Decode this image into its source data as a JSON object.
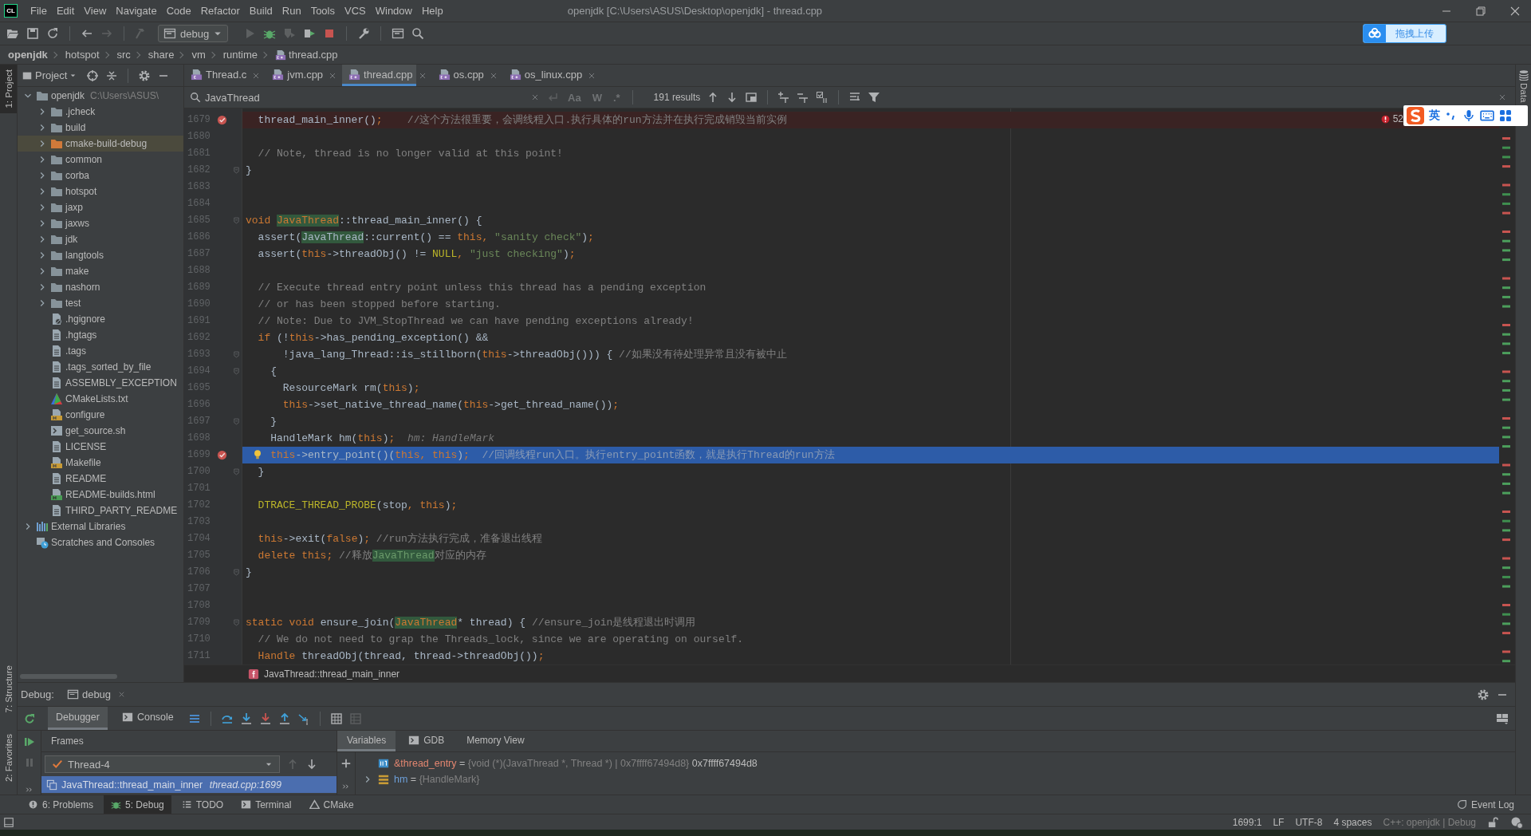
{
  "window": {
    "app_logo": "CL",
    "title": "openjdk [C:\\Users\\ASUS\\Desktop\\openjdk] - thread.cpp"
  },
  "menu": [
    "File",
    "Edit",
    "View",
    "Navigate",
    "Code",
    "Refactor",
    "Build",
    "Run",
    "Tools",
    "VCS",
    "Window",
    "Help"
  ],
  "toolbar": {
    "run_configuration": "debug"
  },
  "upload_widget": {
    "label": "拖拽上传"
  },
  "navigation_bar": [
    {
      "label": "openjdk",
      "kind": "project"
    },
    {
      "label": "hotspot",
      "kind": "folder"
    },
    {
      "label": "src",
      "kind": "folder"
    },
    {
      "label": "share",
      "kind": "folder"
    },
    {
      "label": "vm",
      "kind": "folder"
    },
    {
      "label": "runtime",
      "kind": "folder"
    },
    {
      "label": "thread.cpp",
      "kind": "cpp-file"
    }
  ],
  "left_tool_strip": {
    "top": [
      {
        "label": "1: Project",
        "selected": true
      }
    ],
    "bottom": [
      {
        "label": "7: Structure",
        "selected": false
      },
      {
        "label": "2: Favorites",
        "selected": false
      }
    ]
  },
  "right_tool_strip": [
    {
      "label": "Data"
    }
  ],
  "project_panel": {
    "title": "Project",
    "tree": [
      {
        "label": "openjdk",
        "path": "C:\\Users\\ASUS\\",
        "kind": "folder",
        "expanded": true,
        "selected": false,
        "children": [
          {
            "label": ".jcheck",
            "kind": "folder",
            "expanded": false,
            "selected": false
          },
          {
            "label": "build",
            "kind": "folder",
            "expanded": false,
            "selected": false
          },
          {
            "label": "cmake-build-debug",
            "kind": "excluded-folder",
            "expanded": false,
            "selected": true
          },
          {
            "label": "common",
            "kind": "folder",
            "expanded": false,
            "selected": false
          },
          {
            "label": "corba",
            "kind": "folder",
            "expanded": false,
            "selected": false
          },
          {
            "label": "hotspot",
            "kind": "folder",
            "expanded": false,
            "selected": false
          },
          {
            "label": "jaxp",
            "kind": "folder",
            "expanded": false,
            "selected": false
          },
          {
            "label": "jaxws",
            "kind": "folder",
            "expanded": false,
            "selected": false
          },
          {
            "label": "jdk",
            "kind": "folder",
            "expanded": false,
            "selected": false
          },
          {
            "label": "langtools",
            "kind": "folder",
            "expanded": false,
            "selected": false
          },
          {
            "label": "make",
            "kind": "folder",
            "expanded": false,
            "selected": false
          },
          {
            "label": "nashorn",
            "kind": "folder",
            "expanded": false,
            "selected": false
          },
          {
            "label": "test",
            "kind": "folder",
            "expanded": false,
            "selected": false
          },
          {
            "label": ".hgignore",
            "kind": "ignore-file",
            "selected": false
          },
          {
            "label": ".hgtags",
            "kind": "text-file",
            "selected": false
          },
          {
            "label": ".tags",
            "kind": "text-file",
            "selected": false
          },
          {
            "label": ".tags_sorted_by_file",
            "kind": "text-file",
            "selected": false
          },
          {
            "label": "ASSEMBLY_EXCEPTION",
            "kind": "text-file",
            "selected": false
          },
          {
            "label": "CMakeLists.txt",
            "kind": "cmake-file",
            "selected": false
          },
          {
            "label": "configure",
            "kind": "make-file",
            "selected": false
          },
          {
            "label": "get_source.sh",
            "kind": "script-file",
            "selected": false
          },
          {
            "label": "LICENSE",
            "kind": "text-file",
            "selected": false
          },
          {
            "label": "Makefile",
            "kind": "make-file",
            "selected": false
          },
          {
            "label": "README",
            "kind": "text-file",
            "selected": false
          },
          {
            "label": "README-builds.html",
            "kind": "html-file",
            "selected": false
          },
          {
            "label": "THIRD_PARTY_README",
            "kind": "text-file",
            "selected": false
          }
        ]
      },
      {
        "label": "External Libraries",
        "kind": "libraries",
        "expanded": false,
        "selected": false
      },
      {
        "label": "Scratches and Consoles",
        "kind": "scratches",
        "selected": false
      }
    ]
  },
  "editor_tabs": [
    {
      "label": "Thread.c",
      "kind": "c-file",
      "selected": false
    },
    {
      "label": "jvm.cpp",
      "kind": "cpp-file",
      "selected": false
    },
    {
      "label": "thread.cpp",
      "kind": "cpp-file",
      "selected": true
    },
    {
      "label": "os.cpp",
      "kind": "cpp-file",
      "selected": false
    },
    {
      "label": "os_linux.cpp",
      "kind": "cpp-file",
      "selected": false
    }
  ],
  "find_bar": {
    "query": "JavaThread",
    "match_case": "Aa",
    "words": "W",
    "regex": ".*",
    "results": "191 results"
  },
  "editor": {
    "problems": "52",
    "lines": [
      {
        "number": "1679",
        "breakpoint": true,
        "current": false,
        "fold": false,
        "intention": false,
        "tokens": [
          {
            "kind": "plain",
            "text": "  thread_main_inner()"
          },
          {
            "kind": "keyword",
            "text": ";"
          },
          {
            "kind": "comment",
            "text": "    //这个方法很重要，会调线程入口.执行具体的run方法并在执行完成销毁当前实例"
          }
        ]
      },
      {
        "number": "1680",
        "breakpoint": false,
        "current": false,
        "fold": false,
        "intention": false
      },
      {
        "number": "1681",
        "breakpoint": false,
        "current": false,
        "fold": false,
        "intention": false,
        "tokens": [
          {
            "kind": "comment",
            "text": "  // Note, thread is no longer valid at this point!"
          }
        ]
      },
      {
        "number": "1682",
        "breakpoint": false,
        "current": false,
        "fold": true,
        "intention": false,
        "tokens": [
          {
            "kind": "plain",
            "text": "}"
          }
        ]
      },
      {
        "number": "1683",
        "breakpoint": false,
        "current": false,
        "fold": false,
        "intention": false
      },
      {
        "number": "1684",
        "breakpoint": false,
        "current": false,
        "fold": false,
        "intention": false
      },
      {
        "number": "1685",
        "breakpoint": false,
        "current": false,
        "fold": true,
        "intention": false,
        "tokens": [
          {
            "kind": "keyword",
            "text": "void "
          },
          {
            "kind": "match-keyword",
            "text": "JavaThread"
          },
          {
            "kind": "plain",
            "text": "::thread_main_inner() {"
          }
        ]
      },
      {
        "number": "1686",
        "breakpoint": false,
        "current": false,
        "fold": false,
        "intention": false,
        "tokens": [
          {
            "kind": "plain",
            "text": "  assert("
          },
          {
            "kind": "match",
            "text": "JavaThread"
          },
          {
            "kind": "plain",
            "text": "::current() == "
          },
          {
            "kind": "keyword",
            "text": "this, "
          },
          {
            "kind": "string",
            "text": "\"sanity check\""
          },
          {
            "kind": "plain",
            "text": ")"
          },
          {
            "kind": "keyword",
            "text": ";"
          }
        ]
      },
      {
        "number": "1687",
        "breakpoint": false,
        "current": false,
        "fold": false,
        "intention": false,
        "tokens": [
          {
            "kind": "plain",
            "text": "  assert("
          },
          {
            "kind": "keyword",
            "text": "this"
          },
          {
            "kind": "plain",
            "text": "->threadObj() != "
          },
          {
            "kind": "macro",
            "text": "NULL"
          },
          {
            "kind": "keyword",
            "text": ", "
          },
          {
            "kind": "string",
            "text": "\"just checking\""
          },
          {
            "kind": "plain",
            "text": ")"
          },
          {
            "kind": "keyword",
            "text": ";"
          }
        ]
      },
      {
        "number": "1688",
        "breakpoint": false,
        "current": false,
        "fold": false,
        "intention": false
      },
      {
        "number": "1689",
        "breakpoint": false,
        "current": false,
        "fold": false,
        "intention": false,
        "tokens": [
          {
            "kind": "comment",
            "text": "  // Execute thread entry point unless this thread has a pending exception"
          }
        ]
      },
      {
        "number": "1690",
        "breakpoint": false,
        "current": false,
        "fold": false,
        "intention": false,
        "tokens": [
          {
            "kind": "comment",
            "text": "  // or has been stopped before starting."
          }
        ]
      },
      {
        "number": "1691",
        "breakpoint": false,
        "current": false,
        "fold": false,
        "intention": false,
        "tokens": [
          {
            "kind": "comment",
            "text": "  // Note: Due to JVM_StopThread we can have pending exceptions already!"
          }
        ]
      },
      {
        "number": "1692",
        "breakpoint": false,
        "current": false,
        "fold": false,
        "intention": false,
        "tokens": [
          {
            "kind": "keyword",
            "text": "  if "
          },
          {
            "kind": "plain",
            "text": "(!"
          },
          {
            "kind": "keyword",
            "text": "this"
          },
          {
            "kind": "plain",
            "text": "->has_pending_exception() &&"
          }
        ]
      },
      {
        "number": "1693",
        "breakpoint": false,
        "current": false,
        "fold": true,
        "intention": false,
        "tokens": [
          {
            "kind": "plain",
            "text": "      !java_lang_Thread::is_stillborn("
          },
          {
            "kind": "keyword",
            "text": "this"
          },
          {
            "kind": "plain",
            "text": "->threadObj())) { "
          },
          {
            "kind": "comment",
            "text": "//如果没有待处理异常且没有被中止"
          }
        ]
      },
      {
        "number": "1694",
        "breakpoint": false,
        "current": false,
        "fold": true,
        "intention": false,
        "tokens": [
          {
            "kind": "plain",
            "text": "    {"
          }
        ]
      },
      {
        "number": "1695",
        "breakpoint": false,
        "current": false,
        "fold": false,
        "intention": false,
        "tokens": [
          {
            "kind": "plain",
            "text": "      ResourceMark rm("
          },
          {
            "kind": "keyword",
            "text": "this"
          },
          {
            "kind": "plain",
            "text": ")"
          },
          {
            "kind": "keyword",
            "text": ";"
          }
        ]
      },
      {
        "number": "1696",
        "breakpoint": false,
        "current": false,
        "fold": false,
        "intention": false,
        "tokens": [
          {
            "kind": "keyword",
            "text": "      this"
          },
          {
            "kind": "plain",
            "text": "->set_native_thread_name("
          },
          {
            "kind": "keyword",
            "text": "this"
          },
          {
            "kind": "plain",
            "text": "->get_thread_name())"
          },
          {
            "kind": "keyword",
            "text": ";"
          }
        ]
      },
      {
        "number": "1697",
        "breakpoint": false,
        "current": false,
        "fold": true,
        "intention": false,
        "tokens": [
          {
            "kind": "plain",
            "text": "    }"
          }
        ]
      },
      {
        "number": "1698",
        "breakpoint": false,
        "current": false,
        "fold": false,
        "intention": false,
        "tokens": [
          {
            "kind": "plain",
            "text": "    HandleMark hm("
          },
          {
            "kind": "keyword",
            "text": "this"
          },
          {
            "kind": "plain",
            "text": ")"
          },
          {
            "kind": "keyword",
            "text": ";"
          },
          {
            "kind": "hint",
            "text": "  hm: HandleMark"
          }
        ]
      },
      {
        "number": "1699",
        "breakpoint": true,
        "current": true,
        "fold": false,
        "intention": true,
        "tokens": [
          {
            "kind": "keyword",
            "text": "    this"
          },
          {
            "kind": "plain",
            "text": "->entry_point()("
          },
          {
            "kind": "keyword",
            "text": "this, this"
          },
          {
            "kind": "plain",
            "text": ")"
          },
          {
            "kind": "keyword",
            "text": ";"
          },
          {
            "kind": "comment",
            "text": "  //回调线程run入口。执行entry_point函数，就是执行Thread的run方法"
          }
        ]
      },
      {
        "number": "1700",
        "breakpoint": false,
        "current": false,
        "fold": true,
        "intention": false,
        "tokens": [
          {
            "kind": "plain",
            "text": "  }"
          }
        ]
      },
      {
        "number": "1701",
        "breakpoint": false,
        "current": false,
        "fold": false,
        "intention": false
      },
      {
        "number": "1702",
        "breakpoint": false,
        "current": false,
        "fold": false,
        "intention": false,
        "tokens": [
          {
            "kind": "macro",
            "text": "  DTRACE_THREAD_PROBE"
          },
          {
            "kind": "plain",
            "text": "(stop"
          },
          {
            "kind": "keyword",
            "text": ", this"
          },
          {
            "kind": "plain",
            "text": ")"
          },
          {
            "kind": "keyword",
            "text": ";"
          }
        ]
      },
      {
        "number": "1703",
        "breakpoint": false,
        "current": false,
        "fold": false,
        "intention": false
      },
      {
        "number": "1704",
        "breakpoint": false,
        "current": false,
        "fold": false,
        "intention": false,
        "tokens": [
          {
            "kind": "keyword",
            "text": "  this"
          },
          {
            "kind": "plain",
            "text": "->exit("
          },
          {
            "kind": "keyword",
            "text": "false"
          },
          {
            "kind": "plain",
            "text": ")"
          },
          {
            "kind": "keyword",
            "text": "; "
          },
          {
            "kind": "comment",
            "text": "//run方法执行完成，准备退出线程"
          }
        ]
      },
      {
        "number": "1705",
        "breakpoint": false,
        "current": false,
        "fold": false,
        "intention": false,
        "tokens": [
          {
            "kind": "keyword",
            "text": "  delete this; "
          },
          {
            "kind": "comment",
            "text": "//释放"
          },
          {
            "kind": "match-comment",
            "text": "JavaThread"
          },
          {
            "kind": "comment",
            "text": "对应的内存"
          }
        ]
      },
      {
        "number": "1706",
        "breakpoint": false,
        "current": false,
        "fold": true,
        "intention": false,
        "tokens": [
          {
            "kind": "plain",
            "text": "}"
          }
        ]
      },
      {
        "number": "1707",
        "breakpoint": false,
        "current": false,
        "fold": false,
        "intention": false
      },
      {
        "number": "1708",
        "breakpoint": false,
        "current": false,
        "fold": false,
        "intention": false
      },
      {
        "number": "1709",
        "breakpoint": false,
        "current": false,
        "fold": true,
        "intention": false,
        "tokens": [
          {
            "kind": "keyword",
            "text": "static void "
          },
          {
            "kind": "plain",
            "text": "ensure_join("
          },
          {
            "kind": "match-keyword",
            "text": "JavaThread"
          },
          {
            "kind": "plain",
            "text": "* thread) { "
          },
          {
            "kind": "comment",
            "text": "//ensure_join是线程退出时调用"
          }
        ]
      },
      {
        "number": "1710",
        "breakpoint": false,
        "current": false,
        "fold": false,
        "intention": false,
        "tokens": [
          {
            "kind": "comment",
            "text": "  // We do not need to grap the Threads_lock, since we are operating on ourself."
          }
        ]
      },
      {
        "number": "1711",
        "breakpoint": false,
        "current": false,
        "fold": false,
        "intention": false,
        "tokens": [
          {
            "kind": "keyword",
            "text": "  Handle "
          },
          {
            "kind": "plain",
            "text": "threadObj(thread, thread->threadObj())"
          },
          {
            "kind": "keyword",
            "text": ";"
          }
        ]
      }
    ]
  },
  "editor_breadcrumb": "JavaThread::thread_main_inner",
  "ime_bar": {
    "mode": "英"
  },
  "debug_panel": {
    "title": "Debug:",
    "session": "debug",
    "tabs": [
      {
        "label": "Debugger",
        "kind": "debugger",
        "selected": true
      },
      {
        "label": "Console",
        "kind": "console",
        "selected": false
      }
    ],
    "frames_title": "Frames",
    "thread": "Thread-4",
    "frames": [
      {
        "function": "JavaThread::thread_main_inner",
        "location": "thread.cpp:1699",
        "selected": true
      }
    ],
    "variable_tabs": [
      {
        "label": "Variables",
        "kind": "variables",
        "selected": true
      },
      {
        "label": "GDB",
        "kind": "gdb",
        "selected": false
      },
      {
        "label": "Memory View",
        "kind": "memory",
        "selected": false
      }
    ],
    "variables": [
      {
        "name": "&thread_entry",
        "kind": "pointer",
        "expandable": false,
        "equals": "=",
        "summary": "{void (*)(JavaThread *, Thread *) | 0x7ffff67494d8}",
        "value": "0x7ffff67494d8"
      },
      {
        "name": "hm",
        "kind": "object",
        "expandable": true,
        "equals": "=",
        "summary": "{HandleMark}"
      }
    ]
  },
  "tool_windows_bar": [
    {
      "label": "6: Problems",
      "kind": "problems",
      "selected": false
    },
    {
      "label": "5: Debug",
      "kind": "debug",
      "selected": true
    },
    {
      "label": "TODO",
      "kind": "todo",
      "selected": false
    },
    {
      "label": "Terminal",
      "kind": "terminal",
      "selected": false
    },
    {
      "label": "CMake",
      "kind": "cmake",
      "selected": false
    }
  ],
  "event_log": "Event Log",
  "status_bar": {
    "position": "1699:1",
    "line_separator": "LF",
    "encoding": "UTF-8",
    "indent": "4 spaces",
    "context": "C++: openjdk | Debug"
  }
}
